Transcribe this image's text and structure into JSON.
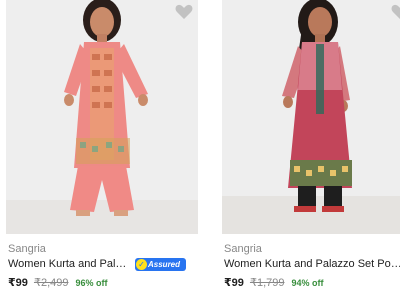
{
  "products": [
    {
      "brand": "Sangria",
      "title": "Women Kurta and Palazzo Set Polyester",
      "assured": "Assured",
      "price": "₹99",
      "mrp": "₹2,499",
      "discount": "96% off",
      "colors": {
        "backdrop": "#eeeeee",
        "garment": "#ee8a86",
        "pattern": "#d6a25a"
      }
    },
    {
      "brand": "Sangria",
      "title": "Women Kurta and Palazzo Set Polyester",
      "price": "₹99",
      "mrp": "₹1,799",
      "discount": "94% off",
      "colors": {
        "backdrop": "#eeeeee",
        "garment": "#c2455a",
        "pattern": "#6a7a4a"
      }
    }
  ],
  "icons": {
    "wishlist": "heart-icon",
    "assured": "shield-icon"
  },
  "colors": {
    "accent": "#2874f0",
    "discount": "#388e3c",
    "muted": "#878787"
  }
}
